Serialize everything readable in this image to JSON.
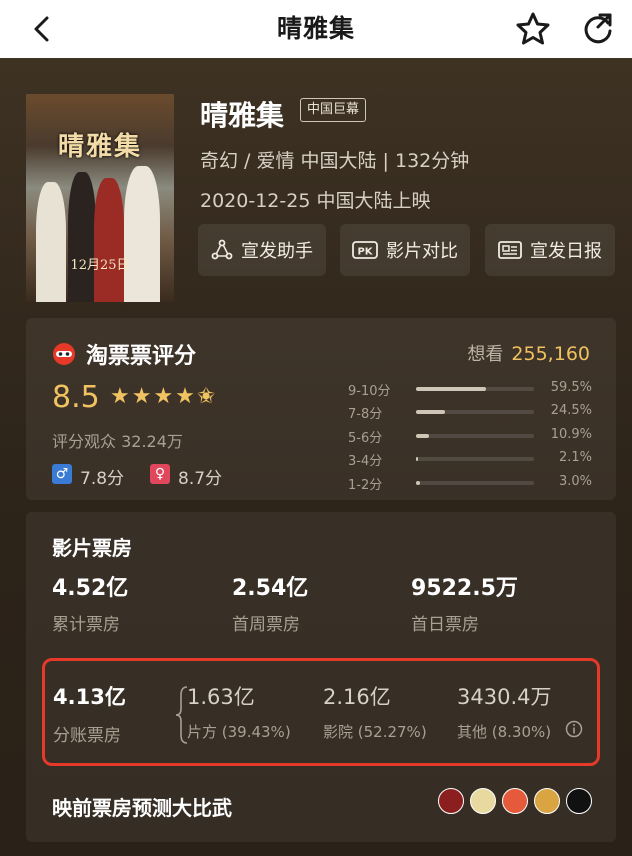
{
  "nav": {
    "title": "晴雅集"
  },
  "poster": {
    "title_text": "晴雅集",
    "date_text": "12月25日"
  },
  "movie": {
    "title": "晴雅集",
    "badge": "中国巨幕",
    "meta": "奇幻 / 爱情 中国大陆 | 132分钟",
    "release": "2020-12-25 中国大陆上映"
  },
  "actions": [
    {
      "label": "宣发助手",
      "icon": "share-nodes-icon"
    },
    {
      "label": "影片对比",
      "icon": "pk-icon"
    },
    {
      "label": "宣发日报",
      "icon": "newspaper-icon"
    }
  ],
  "rating": {
    "title": "淘票票评分",
    "want_label": "想看",
    "want_count": "255,160",
    "score": "8.5",
    "stars": "★★★★✬",
    "audience": "评分观众 32.24万",
    "male_score": "7.8分",
    "female_score": "8.7分",
    "distribution": [
      {
        "label": "9-10分",
        "pct": "59.5%",
        "value": 59.5
      },
      {
        "label": "7-8分",
        "pct": "24.5%",
        "value": 24.5
      },
      {
        "label": "5-6分",
        "pct": "10.9%",
        "value": 10.9
      },
      {
        "label": "3-4分",
        "pct": "2.1%",
        "value": 2.1
      },
      {
        "label": "1-2分",
        "pct": "3.0%",
        "value": 3.0
      }
    ]
  },
  "box_office": {
    "title": "影片票房",
    "stats": [
      {
        "value": "4.52亿",
        "label": "累计票房"
      },
      {
        "value": "2.54亿",
        "label": "首周票房"
      },
      {
        "value": "9522.5万",
        "label": "首日票房"
      }
    ],
    "split": {
      "total_value": "4.13亿",
      "total_label": "分账票房",
      "parts": [
        {
          "value": "1.63亿",
          "label": "片方 (39.43%)"
        },
        {
          "value": "2.16亿",
          "label": "影院 (52.27%)"
        },
        {
          "value": "3430.4万",
          "label": "其他 (8.30%)"
        }
      ]
    },
    "prediction_title": "映前票房预测大比武"
  },
  "colors": {
    "accent": "#f0c261",
    "highlight_border": "#e7392a"
  }
}
